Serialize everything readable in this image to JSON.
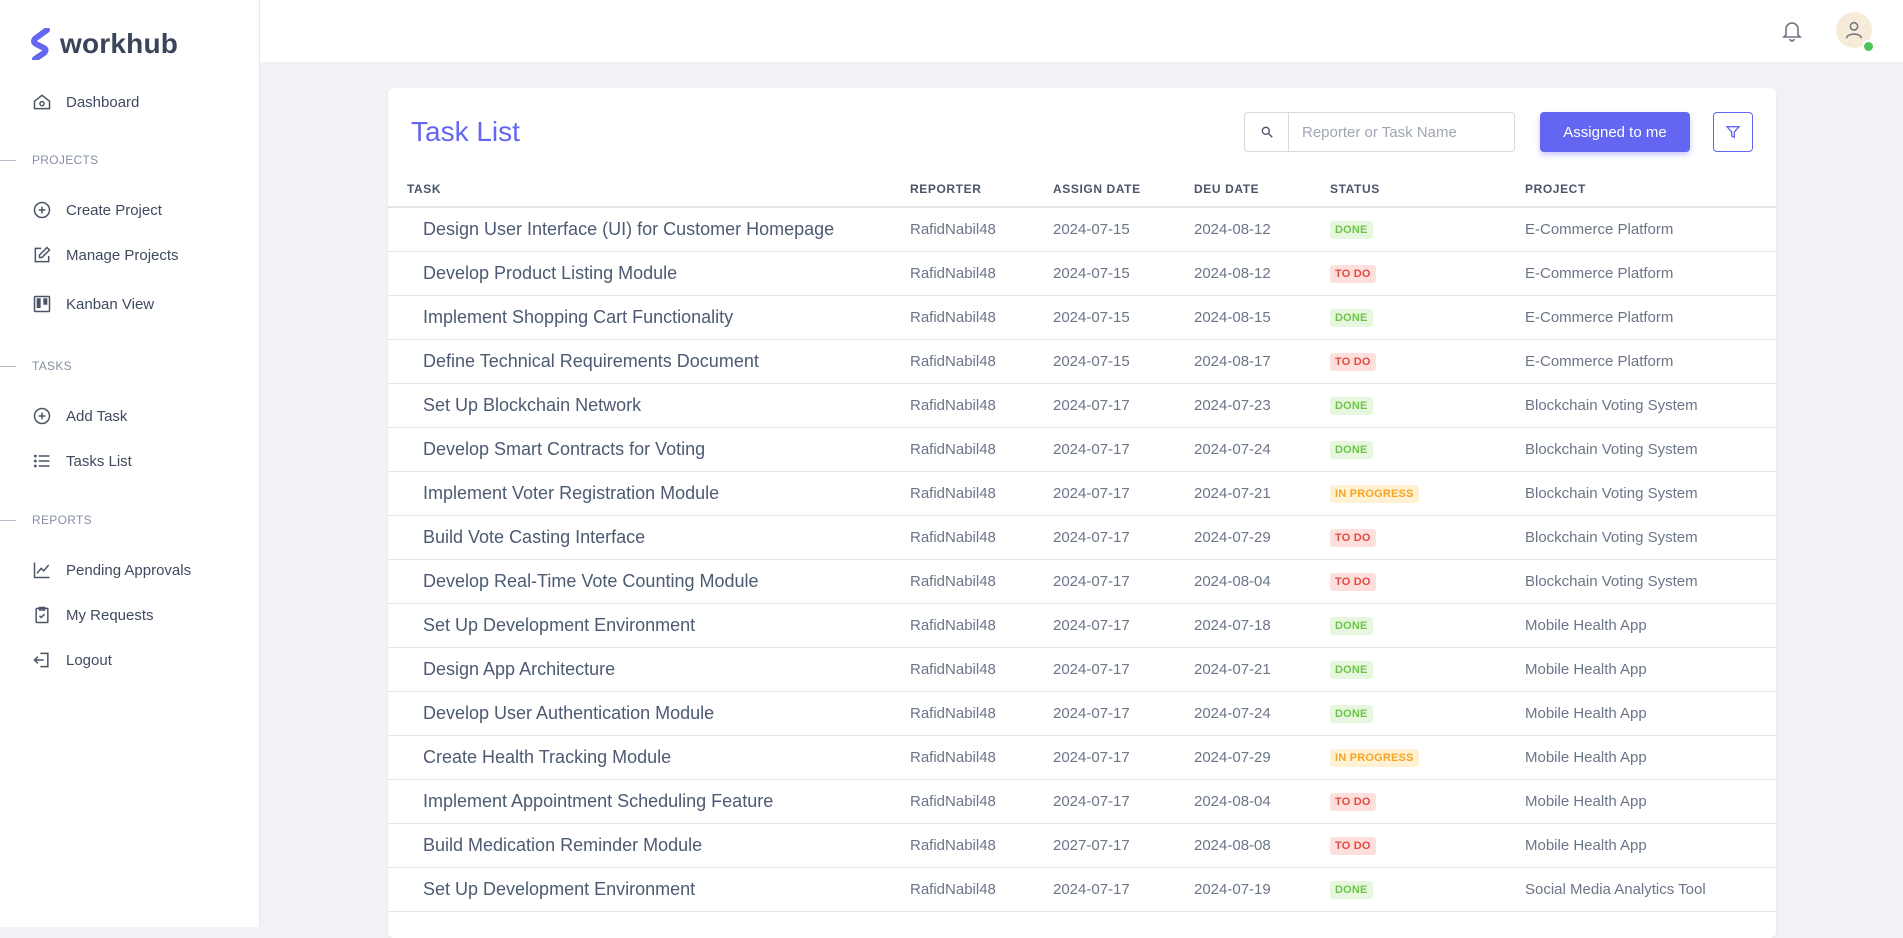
{
  "brand": {
    "name": "workhub"
  },
  "nav": {
    "dashboard": "Dashboard",
    "projects_section": "PROJECTS",
    "create_project": "Create Project",
    "manage_projects": "Manage Projects",
    "kanban_view": "Kanban View",
    "tasks_section": "TASKS",
    "add_task": "Add Task",
    "tasks_list": "Tasks List",
    "reports_section": "REPORTS",
    "pending_approvals": "Pending Approvals",
    "my_requests": "My Requests",
    "logout": "Logout"
  },
  "main": {
    "title": "Task List",
    "search_placeholder": "Reporter or Task Name",
    "assigned_button": "Assigned to me",
    "columns": [
      "TASK",
      "REPORTER",
      "ASSIGN DATE",
      "DEU DATE",
      "STATUS",
      "PROJECT"
    ],
    "rows": [
      {
        "task": "Design User Interface (UI) for Customer Homepage",
        "reporter": "RafidNabil48",
        "assign": "2024-07-15",
        "due": "2024-08-12",
        "status": "DONE",
        "project": "E-Commerce Platform"
      },
      {
        "task": "Develop Product Listing Module",
        "reporter": "RafidNabil48",
        "assign": "2024-07-15",
        "due": "2024-08-12",
        "status": "TO DO",
        "project": "E-Commerce Platform"
      },
      {
        "task": "Implement Shopping Cart Functionality",
        "reporter": "RafidNabil48",
        "assign": "2024-07-15",
        "due": "2024-08-15",
        "status": "DONE",
        "project": "E-Commerce Platform"
      },
      {
        "task": "Define Technical Requirements Document",
        "reporter": "RafidNabil48",
        "assign": "2024-07-15",
        "due": "2024-08-17",
        "status": "TO DO",
        "project": "E-Commerce Platform"
      },
      {
        "task": "Set Up Blockchain Network",
        "reporter": "RafidNabil48",
        "assign": "2024-07-17",
        "due": "2024-07-23",
        "status": "DONE",
        "project": "Blockchain Voting System"
      },
      {
        "task": "Develop Smart Contracts for Voting",
        "reporter": "RafidNabil48",
        "assign": "2024-07-17",
        "due": "2024-07-24",
        "status": "DONE",
        "project": "Blockchain Voting System"
      },
      {
        "task": "Implement Voter Registration Module",
        "reporter": "RafidNabil48",
        "assign": "2024-07-17",
        "due": "2024-07-21",
        "status": "IN PROGRESS",
        "project": "Blockchain Voting System"
      },
      {
        "task": "Build Vote Casting Interface",
        "reporter": "RafidNabil48",
        "assign": "2024-07-17",
        "due": "2024-07-29",
        "status": "TO DO",
        "project": "Blockchain Voting System"
      },
      {
        "task": "Develop Real-Time Vote Counting Module",
        "reporter": "RafidNabil48",
        "assign": "2024-07-17",
        "due": "2024-08-04",
        "status": "TO DO",
        "project": "Blockchain Voting System"
      },
      {
        "task": "Set Up Development Environment",
        "reporter": "RafidNabil48",
        "assign": "2024-07-17",
        "due": "2024-07-18",
        "status": "DONE",
        "project": "Mobile Health App"
      },
      {
        "task": "Design App Architecture",
        "reporter": "RafidNabil48",
        "assign": "2024-07-17",
        "due": "2024-07-21",
        "status": "DONE",
        "project": "Mobile Health App"
      },
      {
        "task": "Develop User Authentication Module",
        "reporter": "RafidNabil48",
        "assign": "2024-07-17",
        "due": "2024-07-24",
        "status": "DONE",
        "project": "Mobile Health App"
      },
      {
        "task": "Create Health Tracking Module",
        "reporter": "RafidNabil48",
        "assign": "2024-07-17",
        "due": "2024-07-29",
        "status": "IN PROGRESS",
        "project": "Mobile Health App"
      },
      {
        "task": "Implement Appointment Scheduling Feature",
        "reporter": "RafidNabil48",
        "assign": "2024-07-17",
        "due": "2024-08-04",
        "status": "TO DO",
        "project": "Mobile Health App"
      },
      {
        "task": "Build Medication Reminder Module",
        "reporter": "RafidNabil48",
        "assign": "2027-07-17",
        "due": "2024-08-08",
        "status": "TO DO",
        "project": "Mobile Health App"
      },
      {
        "task": "Set Up Development Environment",
        "reporter": "RafidNabil48",
        "assign": "2024-07-17",
        "due": "2024-07-19",
        "status": "DONE",
        "project": "Social Media Analytics Tool"
      }
    ]
  },
  "colors": {
    "accent": "#6366f1",
    "done_bg": "#e7f7df",
    "done_fg": "#6cc648",
    "todo_bg": "#fde0de",
    "todo_fg": "#e24a3f",
    "progress_bg": "#fff1d4",
    "progress_fg": "#f5a623"
  },
  "icons": {
    "logo": "logo-s-icon",
    "dashboard": "home-icon",
    "create_project": "plus-circle-icon",
    "manage_projects": "edit-icon",
    "kanban": "kanban-icon",
    "add_task": "plus-circle-icon",
    "tasks_list": "list-icon",
    "pending": "chart-icon",
    "requests": "clipboard-check-icon",
    "logout": "logout-icon",
    "bell": "bell-icon",
    "user": "user-icon",
    "search": "search-icon",
    "filter": "filter-icon"
  }
}
